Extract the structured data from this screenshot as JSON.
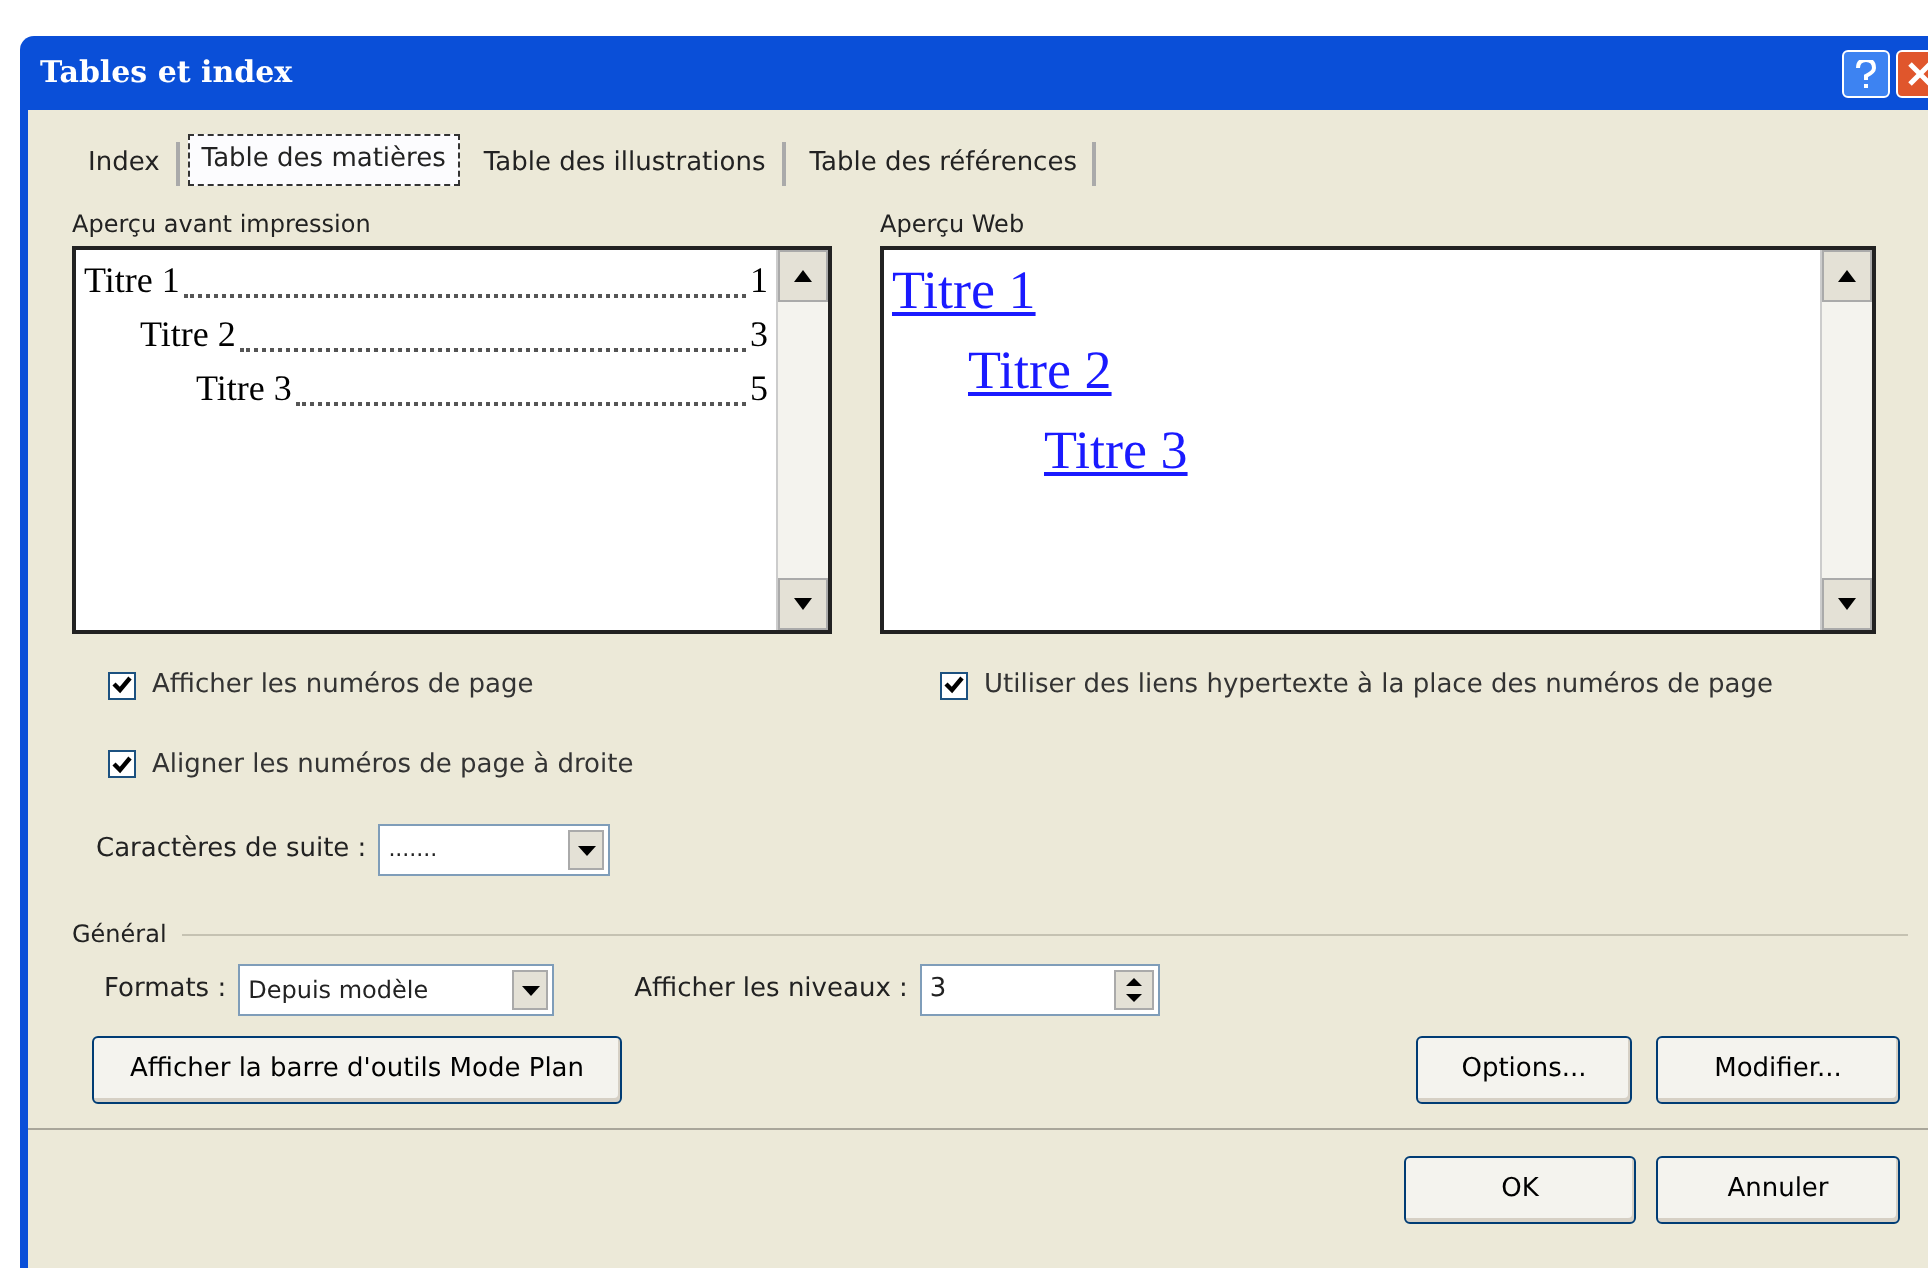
{
  "window": {
    "title": "Tables et index"
  },
  "tabs": [
    {
      "label": "Index",
      "selected": false
    },
    {
      "label": "Table des matières",
      "selected": true
    },
    {
      "label": "Table des illustrations",
      "selected": false
    },
    {
      "label": "Table des références",
      "selected": false
    }
  ],
  "print_preview": {
    "label": "Aperçu avant impression",
    "entries": [
      {
        "title": "Titre 1",
        "page": "1",
        "children": [
          {
            "title": "Titre 2",
            "page": "3",
            "children": [
              {
                "title": "Titre 3",
                "page": "5"
              }
            ]
          }
        ]
      }
    ]
  },
  "web_preview": {
    "label": "Aperçu Web",
    "entries": [
      {
        "title": "Titre 1",
        "children": [
          {
            "title": "Titre 2",
            "children": [
              {
                "title": "Titre 3"
              }
            ]
          }
        ]
      }
    ]
  },
  "left_options": [
    {
      "label": "Afficher les numéros de page",
      "checked": true
    },
    {
      "label": "Aligner les numéros de page à droite",
      "checked": true
    }
  ],
  "right_options": [
    {
      "label": "Utiliser des liens hypertexte à la place des numéros de page",
      "checked": true
    }
  ],
  "leader": {
    "label": "Caractères de suite :",
    "value": "......."
  },
  "general": {
    "label": "Général",
    "formats_label": "Formats :",
    "formats_value": "Depuis modèle",
    "levels_label": "Afficher les niveaux :",
    "levels_value": "3"
  },
  "buttons": {
    "outline": "Afficher la barre d'outils Mode Plan",
    "options": "Options...",
    "modify": "Modifier...",
    "ok": "OK",
    "cancel": "Annuler"
  }
}
